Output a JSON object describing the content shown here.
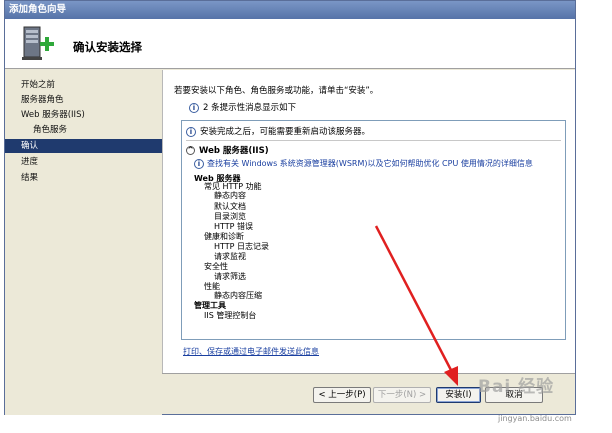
{
  "window": {
    "title": "添加角色向导"
  },
  "header": {
    "title": "确认安装选择",
    "icon": "server-add-icon"
  },
  "nav": {
    "items": [
      {
        "label": "开始之前"
      },
      {
        "label": "服务器角色"
      },
      {
        "label": "Web 服务器(IIS)"
      },
      {
        "label": "角色服务"
      },
      {
        "label": "确认"
      },
      {
        "label": "进度"
      },
      {
        "label": "结果"
      }
    ]
  },
  "content": {
    "intro": "若要安装以下角色、角色服务或功能，请单击“安装”。",
    "warning_count": "2 条提示性消息显示如下",
    "box": {
      "note": "安装完成之后，可能需要重新启动该服务器。",
      "section_title": "Web 服务器(IIS)",
      "help_link": "查找有关 Windows 系统资源管理器(WSRM)以及它如何帮助优化 CPU 使用情况的详细信息",
      "tree": [
        "Web 服务器",
        "常见 HTTP 功能",
        "静态内容",
        "默认文档",
        "目录浏览",
        "HTTP 错误",
        "健康和诊断",
        "HTTP 日志记录",
        "请求监视",
        "安全性",
        "请求筛选",
        "性能",
        "静态内容压缩",
        "管理工具",
        "IIS 管理控制台"
      ]
    },
    "bottom_link": "打印、保存或通过电子邮件发送此信息"
  },
  "buttons": {
    "prev": "< 上一步(P)",
    "next": "下一步(N) >",
    "install": "安装(I)",
    "cancel": "取消"
  },
  "watermark": {
    "brand": "Bai 经验",
    "url": "jingyan.baidu.com"
  },
  "colors": {
    "nav_selected": "#1f3a6e",
    "titlebar": "#5673a8",
    "annotation_arrow": "#e02020"
  }
}
